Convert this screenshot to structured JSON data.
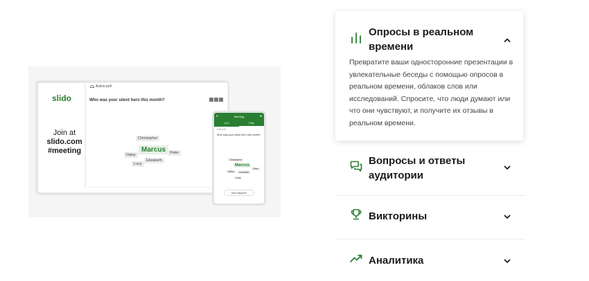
{
  "illustration": {
    "logo": "slido",
    "join_line1": "Join at",
    "join_line2": "slido.com",
    "join_line3": "#meeting",
    "active_poll": "Active poll",
    "question": "Who was your silent hero this month?",
    "words": [
      "Christopher",
      "Marcus",
      "Peter",
      "Daisy",
      "Elizabeth",
      "Lucy"
    ],
    "phone": {
      "title": "Meeting",
      "tabs": [
        "Q&A",
        "Polls"
      ],
      "sub": "Live poll",
      "question": "Who was your silent hero this month?",
      "add_response": "Add response"
    }
  },
  "accordion": {
    "items": [
      {
        "title": "Опросы в реальном времени",
        "icon": "bar-chart-icon",
        "expanded": true,
        "body": "Превратите ваши односторонние презентации в увлекательные беседы с помощью опросов в реальном времени, облаков слов или исследований. Спросите, что люди думают или что они чувствуют, и получите их отзывы в реальном времени."
      },
      {
        "title": "Вопросы и ответы аудитории",
        "icon": "chat-bubbles-icon",
        "expanded": false
      },
      {
        "title": "Викторины",
        "icon": "trophy-icon",
        "expanded": false
      },
      {
        "title": "Аналитика",
        "icon": "trend-up-icon",
        "expanded": false
      }
    ]
  },
  "colors": {
    "brand_green": "#2a7f32",
    "text": "#1b1b1b",
    "muted": "#444444"
  }
}
